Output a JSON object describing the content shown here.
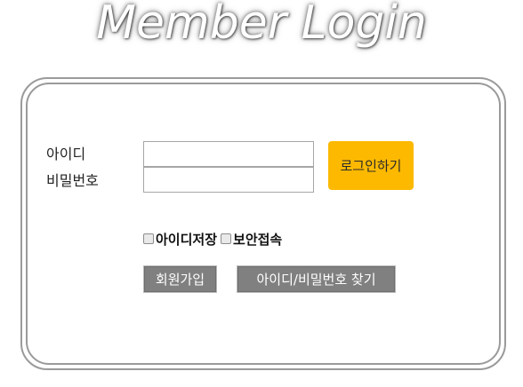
{
  "header": {
    "title": "Member Login"
  },
  "form": {
    "id_label": "아이디",
    "password_label": "비밀번호",
    "id_value": "",
    "password_value": "",
    "login_button": "로그인하기",
    "save_id_label": "아이디저장",
    "secure_login_label": "보안접속",
    "save_id_checked": false,
    "secure_login_checked": false,
    "join_button": "회원가입",
    "find_button": "아이디/비밀번호 찾기"
  },
  "colors": {
    "login_button": "#fcb900",
    "secondary_button": "#808080",
    "border": "#9a9a9a"
  }
}
